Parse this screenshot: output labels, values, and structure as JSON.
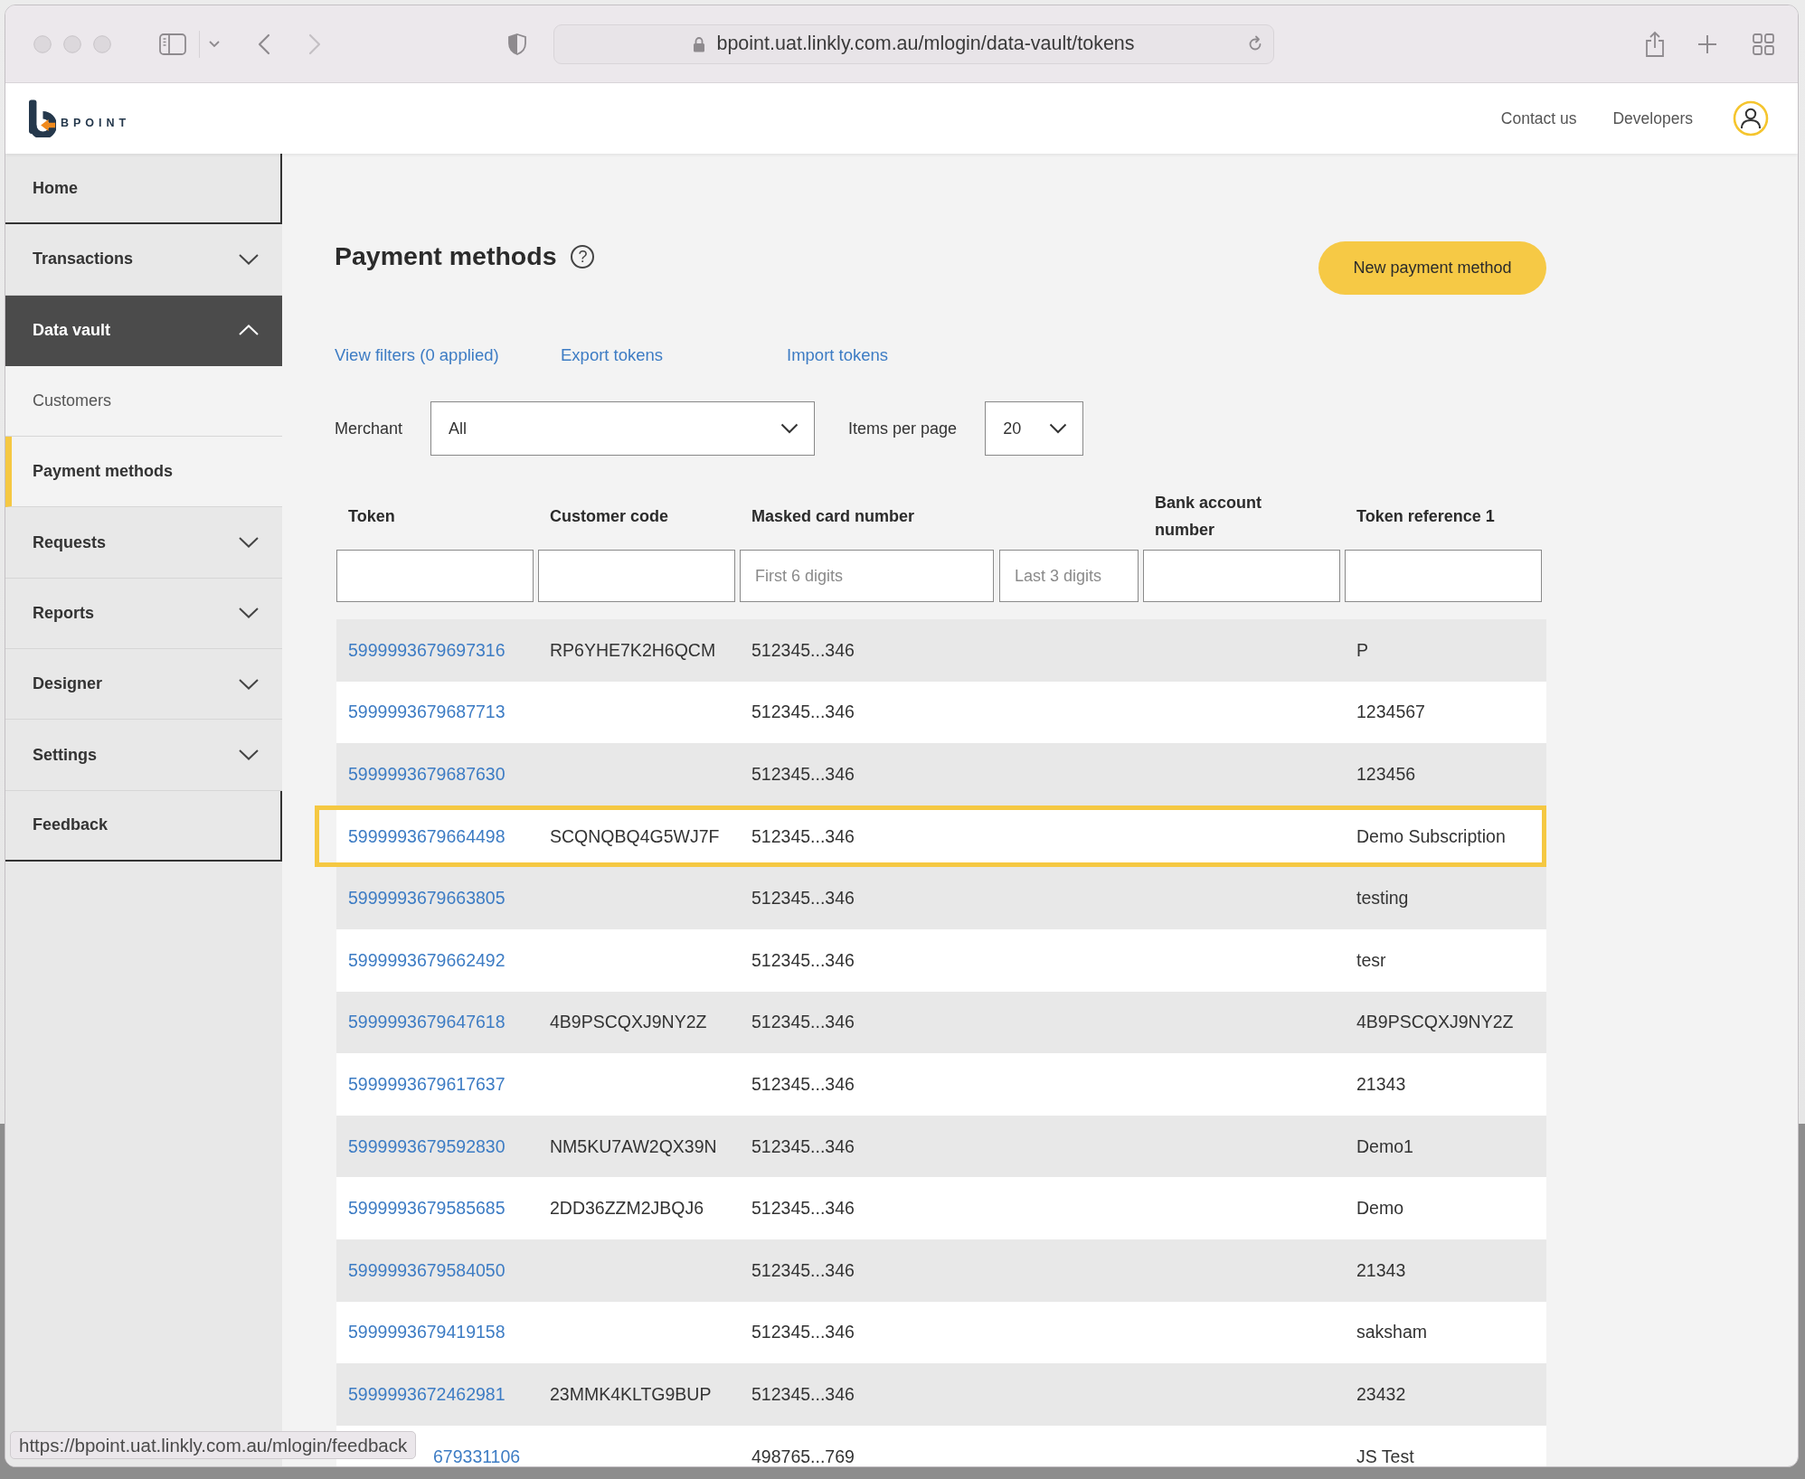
{
  "browser": {
    "url": "bpoint.uat.linkly.com.au/mlogin/data-vault/tokens"
  },
  "header": {
    "logo_text": "BPOINT",
    "links": [
      "Contact us",
      "Developers"
    ]
  },
  "sidebar": {
    "items": [
      {
        "label": "Home",
        "kind": "link",
        "selected": false
      },
      {
        "label": "Transactions",
        "kind": "group",
        "selected": false,
        "expanded": false
      },
      {
        "label": "Data vault",
        "kind": "group",
        "selected": false,
        "expanded": true,
        "children": [
          {
            "label": "Customers",
            "selected": false
          },
          {
            "label": "Payment methods",
            "selected": true
          }
        ]
      },
      {
        "label": "Requests",
        "kind": "group",
        "selected": false,
        "expanded": false
      },
      {
        "label": "Reports",
        "kind": "group",
        "selected": false,
        "expanded": false
      },
      {
        "label": "Designer",
        "kind": "group",
        "selected": false,
        "expanded": false
      },
      {
        "label": "Settings",
        "kind": "group",
        "selected": false,
        "expanded": false
      },
      {
        "label": "Feedback",
        "kind": "link",
        "selected": false
      }
    ]
  },
  "page": {
    "title": "Payment methods",
    "help_icon": "?",
    "primary_button": "New payment method",
    "links": [
      "View filters (0 applied)",
      "Export tokens",
      "Import tokens"
    ],
    "filters": [
      {
        "label": "Merchant",
        "value": "All"
      },
      {
        "label": "Items per page",
        "value": "20"
      }
    ]
  },
  "table": {
    "columns": [
      {
        "label": "Token",
        "filters": [
          {
            "kind": "text"
          }
        ]
      },
      {
        "label": "Customer code",
        "filters": [
          {
            "kind": "text"
          }
        ]
      },
      {
        "label": "Masked card number",
        "filters": [
          {
            "kind": "text",
            "placeholder": "First 6 digits"
          },
          {
            "kind": "text",
            "placeholder": "Last 3 digits"
          }
        ]
      },
      {
        "label": "Bank account number",
        "filters": [
          {
            "kind": "text"
          }
        ]
      },
      {
        "label": "Token reference 1",
        "filters": [
          {
            "kind": "text"
          }
        ]
      }
    ],
    "rows": [
      {
        "token": "5999993679697316",
        "customer_code": "RP6YHE7K2H6QCM",
        "masked_card": "512345...346",
        "token_reference": "P",
        "highlighted": false,
        "obscured": false
      },
      {
        "token": "5999993679687713",
        "masked_card": "512345...346",
        "token_reference": "1234567",
        "highlighted": false,
        "obscured": false
      },
      {
        "token": "5999993679687630",
        "masked_card": "512345...346",
        "token_reference": "123456",
        "highlighted": false,
        "obscured": false
      },
      {
        "token": "5999993679664498",
        "customer_code": "SCQNQBQ4G5WJ7F",
        "masked_card": "512345...346",
        "token_reference": "Demo Subscription",
        "highlighted": true,
        "obscured": false
      },
      {
        "token": "5999993679663805",
        "masked_card": "512345...346",
        "token_reference": "testing",
        "highlighted": false,
        "obscured": false
      },
      {
        "token": "5999993679662492",
        "masked_card": "512345...346",
        "token_reference": "tesr",
        "highlighted": false,
        "obscured": false
      },
      {
        "token": "5999993679647618",
        "customer_code": "4B9PSCQXJ9NY2Z",
        "masked_card": "512345...346",
        "token_reference": "4B9PSCQXJ9NY2Z",
        "highlighted": false,
        "obscured": false
      },
      {
        "token": "5999993679617637",
        "masked_card": "512345...346",
        "token_reference": "21343",
        "highlighted": false,
        "obscured": false
      },
      {
        "token": "5999993679592830",
        "customer_code": "NM5KU7AW2QX39N",
        "masked_card": "512345...346",
        "token_reference": "Demo1",
        "highlighted": false,
        "obscured": false
      },
      {
        "token": "5999993679585685",
        "customer_code": "2DD36ZZM2JBQJ6",
        "masked_card": "512345...346",
        "token_reference": "Demo",
        "highlighted": false,
        "obscured": false
      },
      {
        "token": "5999993679584050",
        "masked_card": "512345...346",
        "token_reference": "21343",
        "highlighted": false,
        "obscured": false
      },
      {
        "token": "5999993679419158",
        "masked_card": "512345...346",
        "token_reference": "saksham",
        "highlighted": false,
        "obscured": false
      },
      {
        "token": "5999993672462981",
        "customer_code": "23MMK4KLTG9BUP",
        "masked_card": "512345...346",
        "token_reference": "23432",
        "highlighted": false,
        "obscured": false
      },
      {
        "token": "679331106",
        "masked_card": "498765...769",
        "token_reference": "JS Test",
        "highlighted": false,
        "obscured": true
      }
    ]
  },
  "status_bar": {
    "url": "https://bpoint.uat.linkly.com.au/mlogin/feedback"
  }
}
